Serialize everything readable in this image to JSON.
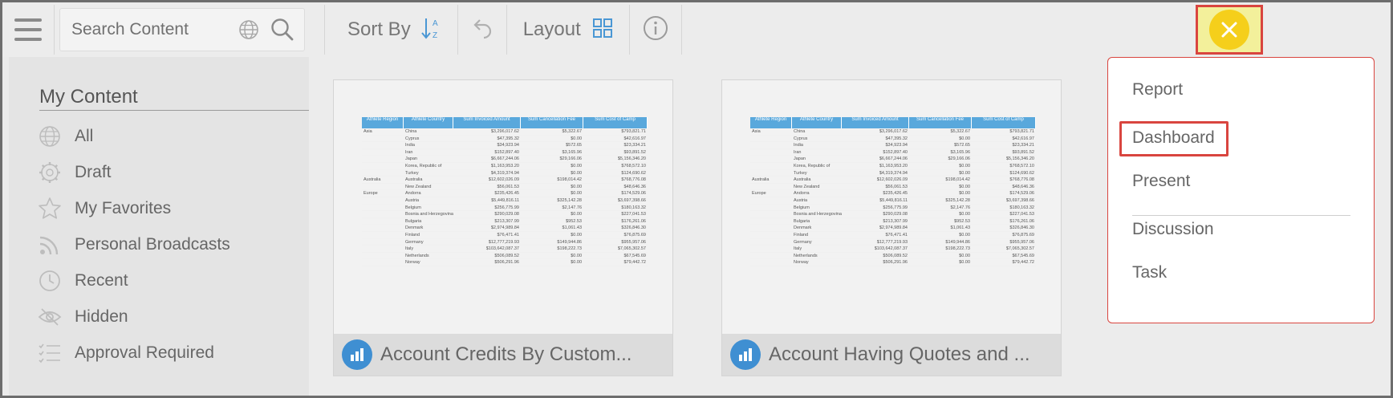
{
  "toolbar": {
    "search_placeholder": "Search Content",
    "sort_label": "Sort By",
    "layout_label": "Layout"
  },
  "sidebar": {
    "title": "My Content",
    "items": [
      {
        "label": "All",
        "icon": "globe-icon"
      },
      {
        "label": "Draft",
        "icon": "gear-icon"
      },
      {
        "label": "My Favorites",
        "icon": "star-icon"
      },
      {
        "label": "Personal Broadcasts",
        "icon": "rss-icon"
      },
      {
        "label": "Recent",
        "icon": "clock-icon"
      },
      {
        "label": "Hidden",
        "icon": "eye-slash-icon"
      },
      {
        "label": "Approval Required",
        "icon": "checklist-icon"
      }
    ]
  },
  "cards": [
    {
      "title": "Account Credits By Custom..."
    },
    {
      "title": "Account Having Quotes and ..."
    }
  ],
  "thumbnail_table": {
    "headers": [
      "Athlete Region",
      "Athlete Country",
      "Sum Invoiced Amount",
      "Sum Cancellation Fee",
      "Sum Cost of Camp"
    ],
    "rows": [
      [
        "Asia",
        "China",
        "$3,296,017.62",
        "$5,322.67",
        "$793,821.71"
      ],
      [
        "",
        "Cyprus",
        "$47,395.32",
        "$0.00",
        "$42,616.97"
      ],
      [
        "",
        "India",
        "$34,923.94",
        "$572.65",
        "$23,334.21"
      ],
      [
        "",
        "Iran",
        "$152,897.40",
        "$3,165.96",
        "$93,891.52"
      ],
      [
        "",
        "Japan",
        "$6,667,244.06",
        "$29,166.06",
        "$5,156,346.20"
      ],
      [
        "",
        "Korea, Republic of",
        "$1,163,953.20",
        "$0.00",
        "$768,572.10"
      ],
      [
        "",
        "Turkey",
        "$4,319,374.94",
        "$0.00",
        "$124,690.62"
      ],
      [
        "Australia",
        "Australia",
        "$12,602,026.09",
        "$198,014.42",
        "$768,776.08"
      ],
      [
        "",
        "New Zealand",
        "$56,061.53",
        "$0.00",
        "$48,646.36"
      ],
      [
        "Europe",
        "Andorra",
        "$235,426.45",
        "$0.00",
        "$174,529.06"
      ],
      [
        "",
        "Austria",
        "$5,449,816.11",
        "$325,142.28",
        "$3,697,398.66"
      ],
      [
        "",
        "Belgium",
        "$256,775.99",
        "$2,147.76",
        "$180,163.32"
      ],
      [
        "",
        "Bosnia and Herzegovina",
        "$290,029.08",
        "$0.00",
        "$227,041.53"
      ],
      [
        "",
        "Bulgaria",
        "$213,307.99",
        "$952.53",
        "$176,261.06"
      ],
      [
        "",
        "Denmark",
        "$2,974,989.84",
        "$1,061.43",
        "$326,846.30"
      ],
      [
        "",
        "Finland",
        "$76,471.41",
        "$0.00",
        "$76,875.69"
      ],
      [
        "",
        "Germany",
        "$12,777,219.93",
        "$149,944.86",
        "$955,957.06"
      ],
      [
        "",
        "Italy",
        "$103,642,087.37",
        "$198,222.73",
        "$7,065,302.57"
      ],
      [
        "",
        "Netherlands",
        "$506,089.52",
        "$0.00",
        "$67,545.69"
      ],
      [
        "",
        "Norway",
        "$506,291.96",
        "$0.00",
        "$79,442.72"
      ]
    ]
  },
  "menu": {
    "items": [
      "Report",
      "Dashboard",
      "Present",
      "Discussion",
      "Task"
    ]
  },
  "colors": {
    "accent_blue": "#3f8fd2",
    "close_yellow": "#f5cf1b",
    "highlight_red": "#d9453f"
  }
}
